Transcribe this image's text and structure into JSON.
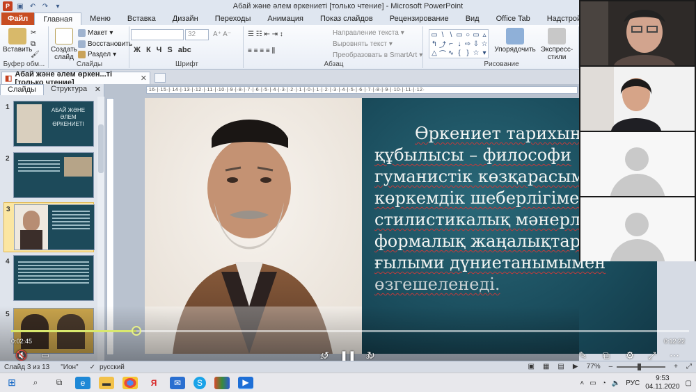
{
  "window": {
    "title": "Абай және әлем өркениеті [только чтение] - Microsoft PowerPoint",
    "app_icon": "P"
  },
  "ribbon_tabs": [
    "Файл",
    "Главная",
    "Меню",
    "Вставка",
    "Дизайн",
    "Переходы",
    "Анимация",
    "Показ слайдов",
    "Рецензирование",
    "Вид",
    "Office Tab",
    "Надстройки"
  ],
  "ribbon": {
    "paste": "Вставить",
    "clipboard_group": "Буфер обм...",
    "new_slide": "Создать слайд",
    "layout": "Макет",
    "reset": "Восстановить",
    "section": "Раздел",
    "slides_group": "Слайды",
    "font_size": "32",
    "font_group": "Шрифт",
    "text_direction": "Направление текста",
    "align_text": "Выровнять текст",
    "smartart": "Преобразовать в SmartArt",
    "paragraph_group": "Абзац",
    "arrange": "Упорядочить",
    "quick_styles": "Экспресс-стили",
    "drawing_group": "Рисование",
    "format_buttons": [
      "Ж",
      "К",
      "Ч",
      "S",
      "abc"
    ]
  },
  "doc_tab": {
    "label": "Абай және әлем өркен...ті [только чтение]"
  },
  "left_pane": {
    "tab_slides": "Слайды",
    "tab_outline": "Структура",
    "thumbs": [
      {
        "num": "1",
        "title": "АБАЙ ЖӘНЕ ӘЛЕМ ӨРКЕНИЕТІ"
      },
      {
        "num": "2",
        "title": ""
      },
      {
        "num": "3",
        "title": ""
      },
      {
        "num": "4",
        "title": ""
      },
      {
        "num": "5",
        "title": ""
      }
    ]
  },
  "ruler": {
    "marks": "·16·|·15·|·14·|·13·|·12·|·11·|·10·|·9·|·8·|·7·|·6·|·5·|·4·|·3·|·2·|·1·|·0·|·1·|·2·|·3·|·4·|·5·|·6·|·7·|·8·|·9·|·10·|·11·|·12·"
  },
  "slide": {
    "lines": [
      "Өркениет тарихын",
      "құбылысы – философи",
      "гуманистік көзқарасым",
      "көркемдік шеберлігімен",
      "стилистикалық мәнерлі",
      "формалық жаңалықтарымен,",
      "ғылыми дүниетанымымен",
      "өзгешеленеді."
    ]
  },
  "video": {
    "elapsed": "0:02:45",
    "total": "0:12:22",
    "progress": 0.185,
    "skip_back": "10",
    "skip_fwd": "30"
  },
  "status": {
    "slide_info": "Слайд 3 из 13",
    "theme": "\"Ион\"",
    "language": "русский",
    "zoom": "77%"
  },
  "taskbar": {
    "lang": "РУС",
    "time": "9:53",
    "date": "04.11.2020"
  }
}
